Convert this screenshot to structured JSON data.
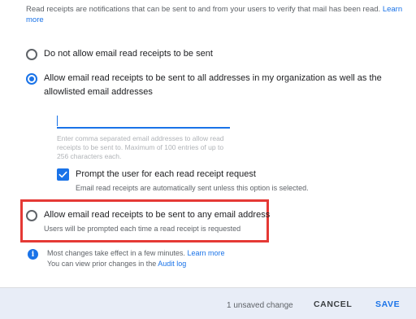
{
  "intro": {
    "text": "Read receipts are notifications that can be sent to and from your users to verify that mail has been read.",
    "link": "Learn more"
  },
  "options": [
    {
      "label": "Do not allow email read receipts to be sent",
      "checked": false
    },
    {
      "label": "Allow email read receipts to be sent to all addresses in my organization as well as the allowlisted email addresses",
      "checked": true
    },
    {
      "label": "Allow email read receipts to be sent to any email address",
      "sublabel": "Users will be prompted each time a read receipt is requested",
      "checked": false
    }
  ],
  "allowlist": {
    "value": "",
    "hint": "Enter comma separated email addresses to allow read receipts to be sent to. Maximum of 100 entries of up to 256 characters each."
  },
  "prompt_checkbox": {
    "label": "Prompt the user for each read receipt request",
    "sublabel": "Email read receipts are automatically sent unless this option is selected.",
    "checked": true
  },
  "info": {
    "line1": "Most changes take effect in a few minutes.",
    "line1_link": "Learn more",
    "line2": "You can view prior changes in the",
    "line2_link": "Audit log"
  },
  "footer": {
    "status": "1 unsaved change",
    "cancel": "CANCEL",
    "save": "SAVE"
  },
  "colors": {
    "accent": "#1a73e8",
    "highlight": "#e53935",
    "footer_bg": "#e8edf7"
  },
  "icons": [
    "radio-unchecked-icon",
    "radio-checked-icon",
    "checkmark-icon",
    "info-icon"
  ]
}
